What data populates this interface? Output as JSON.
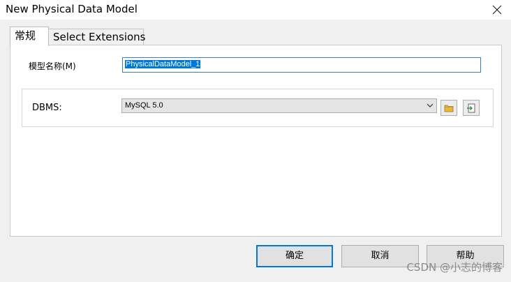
{
  "window": {
    "title": "New Physical Data Model"
  },
  "tabs": [
    {
      "label": "常规",
      "active": true
    },
    {
      "label": "Select Extensions",
      "active": false
    }
  ],
  "form": {
    "name_label": "模型名称(M)",
    "name_value": "PhysicalDataModel_1",
    "dbms_label": "DBMS:",
    "dbms_selected": "MySQL 5.0"
  },
  "buttons": {
    "ok": "确定",
    "cancel": "取消",
    "help": "帮助"
  },
  "watermark": "CSDN @小志的博客",
  "colors": {
    "accent": "#0078d7",
    "selection": "#0078d7",
    "folder": "#e8b83a",
    "import": "#3a9a3a"
  },
  "icons": [
    "close-icon",
    "chevron-down-icon",
    "folder-icon",
    "import-icon"
  ]
}
